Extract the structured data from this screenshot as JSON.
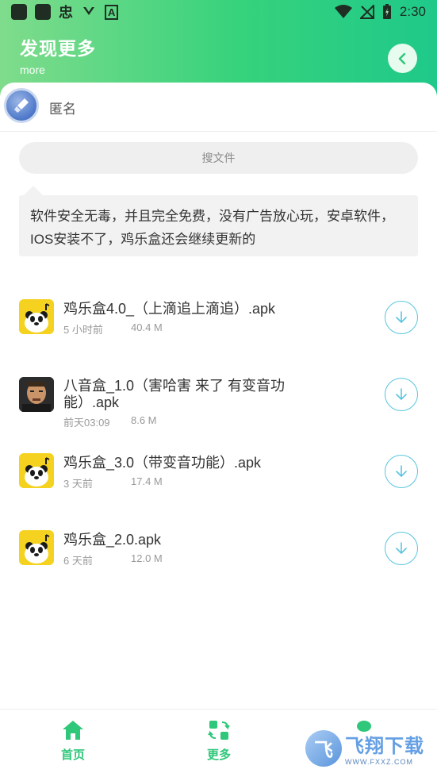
{
  "status_bar": {
    "time": "2:30",
    "app_glyph_1": "忠",
    "app_glyph_2": "A"
  },
  "header": {
    "title": "发现更多",
    "subtitle": "more"
  },
  "user": {
    "name": "匿名"
  },
  "search": {
    "placeholder": "搜文件"
  },
  "description": "软件安全无毒，并且完全免费，没有广告放心玩，安卓软件，IOS安装不了，鸡乐盒还会继续更新的",
  "files": [
    {
      "title": "鸡乐盒4.0_（上滴追上滴追）.apk",
      "time": "5 小时前",
      "size": "40.4 M",
      "icon": "panda"
    },
    {
      "title": "八音盒_1.0（害哈害 来了 有变音功能）.apk",
      "time": "前天03:09",
      "size": "8.6 M",
      "icon": "man"
    },
    {
      "title": "鸡乐盒_3.0（带变音功能）.apk",
      "time": "3 天前",
      "size": "17.4 M",
      "icon": "panda"
    },
    {
      "title": "鸡乐盒_2.0.apk",
      "time": "6 天前",
      "size": "12.0 M",
      "icon": "panda"
    }
  ],
  "nav": {
    "home_label": "首页",
    "more_label": "更多"
  },
  "watermark": {
    "text": "飞翔下载",
    "url": "WWW.FXXZ.COM"
  },
  "colors": {
    "accent": "#2fc77a",
    "download": "#5ac4e0"
  }
}
